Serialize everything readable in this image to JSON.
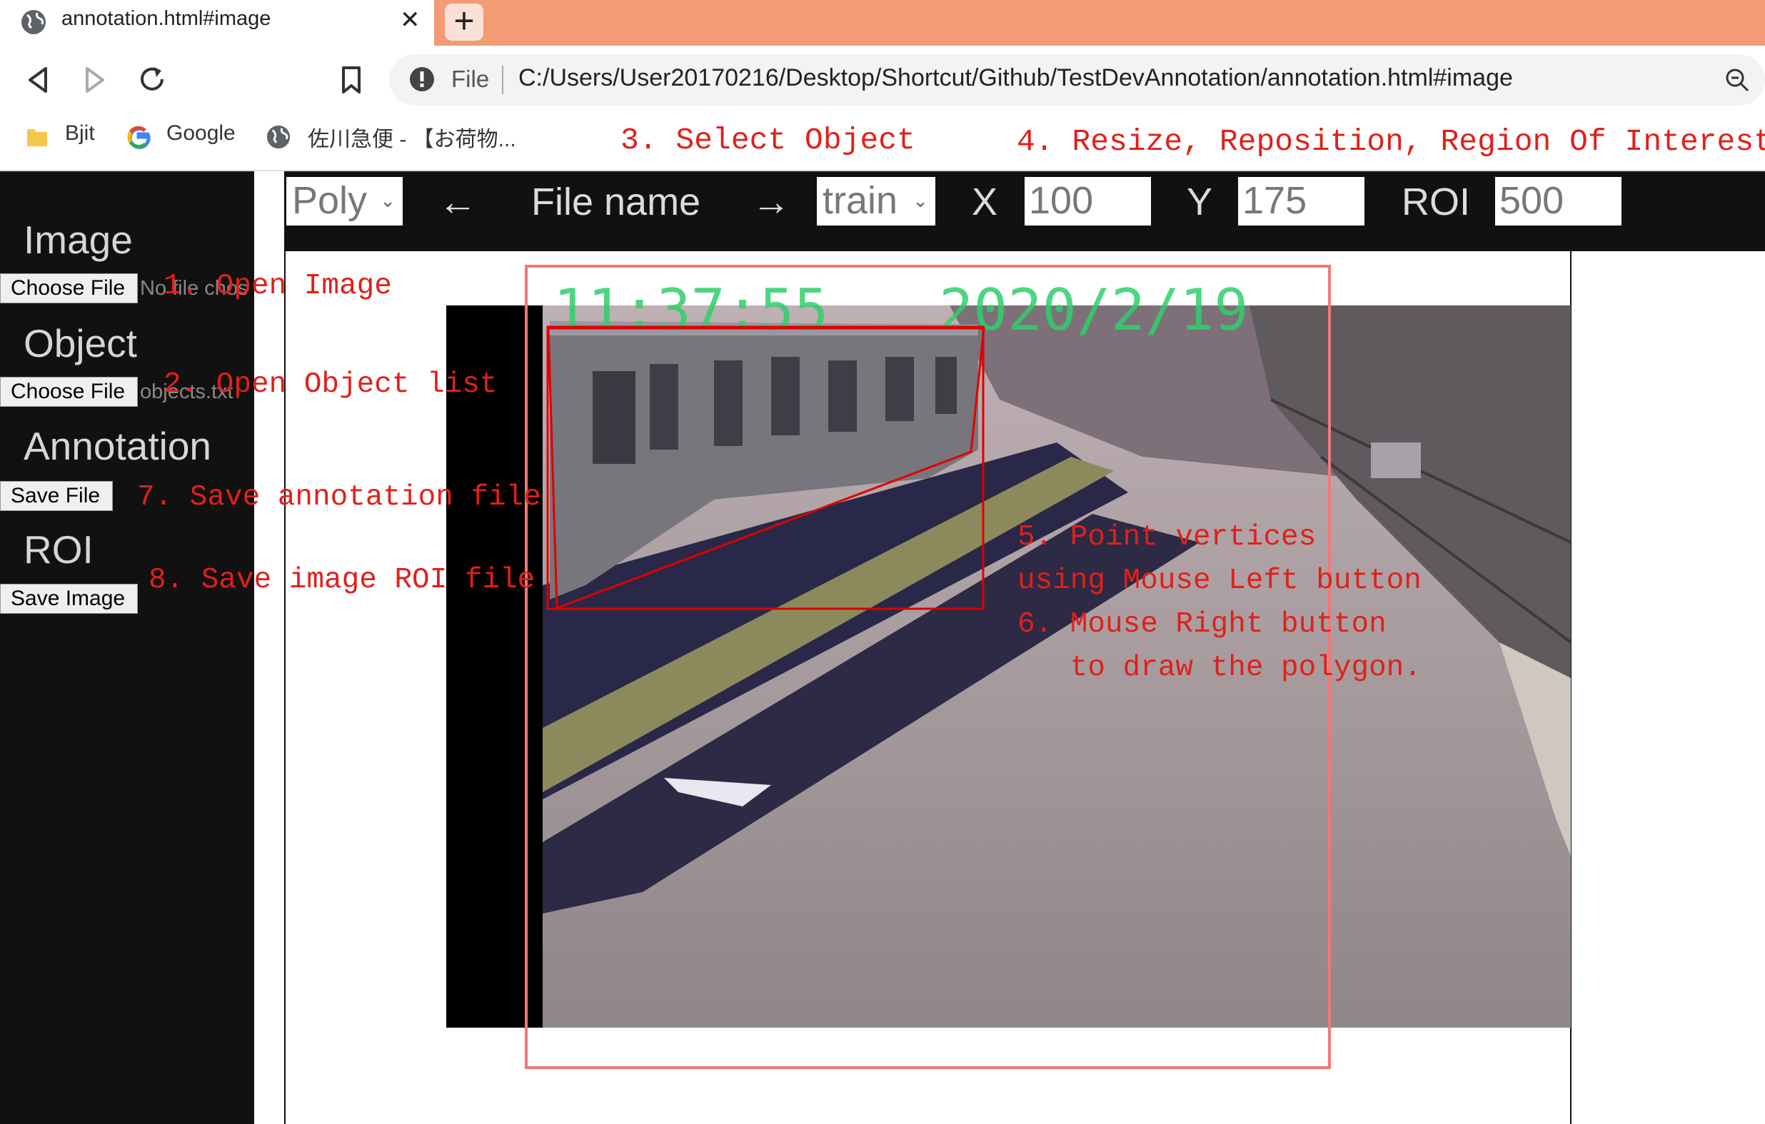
{
  "browser": {
    "tab_title": "annotation.html#image",
    "tab_close": "✕",
    "new_tab": "+",
    "url_scheme": "File",
    "url": "C:/Users/User20170216/Desktop/Shortcut/Github/TestDevAnnotation/annotation.html#image",
    "bookmarks": [
      "Bjit",
      "Google",
      "佐川急便 - 【お荷物..."
    ]
  },
  "sidebar": {
    "image_heading": "Image",
    "image_button": "Choose File",
    "image_file": "No file chosen",
    "object_heading": "Object",
    "object_button": "Choose File",
    "object_file": "objects.txt",
    "annotation_heading": "Annotation",
    "annotation_button": "Save File",
    "roi_heading": "ROI",
    "roi_button": "Save Image"
  },
  "controls": {
    "shape_value": "Poly",
    "prev_arrow": "←",
    "file_name": "File name",
    "next_arrow": "→",
    "object_value": "train",
    "x_label": "X",
    "x_value": "100",
    "y_label": "Y",
    "y_value": "175",
    "roi_label": "ROI",
    "roi_value": "500"
  },
  "annotations": {
    "step1": "1. Open Image",
    "step2": "2. Open Object list",
    "step3": "3. Select Object",
    "step4": "4. Resize, Reposition, Region Of Interest",
    "step5_line1": "5. Point vertices",
    "step5_line2": "using Mouse Left button",
    "step6_line1": "6. Mouse Right button",
    "step6_line2": "   to draw the polygon.",
    "step7": "7. Save annotation file",
    "step8": "8. Save image ROI file"
  },
  "video_overlay": {
    "time": "11:37:55",
    "date": "2020/2/19"
  },
  "colors": {
    "tabbar": "#f29b74",
    "panel": "#111111",
    "annotation_red": "#e0201b",
    "roi_box": "#f07878",
    "polygon": "#e00000"
  }
}
